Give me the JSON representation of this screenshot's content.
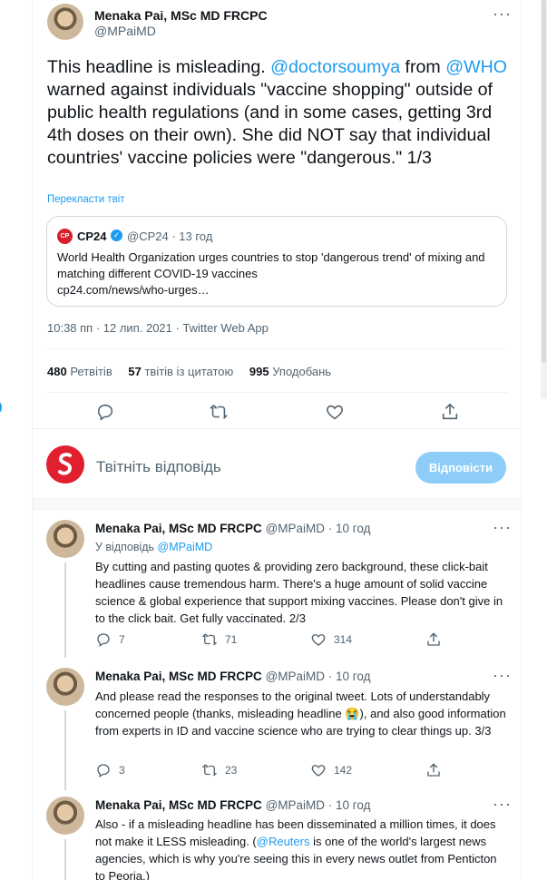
{
  "main_tweet": {
    "name": "Menaka Pai, MSc MD FRCPC",
    "handle": "@MPaiMD",
    "text_part1": "This headline is misleading. ",
    "mention1": "@doctorsoumya",
    "text_part2": " from ",
    "mention2": "@WHO",
    "text_part3": "  warned against individuals \"vaccine shopping\" outside of public health regulations (and in some cases, getting 3rd 4th doses on their own). She did NOT say that individual countries' vaccine policies were \"dangerous.\" 1/3",
    "translate_label": "Перекласти твіт",
    "quote": {
      "logo_text": "CP",
      "name": "CP24",
      "handle_time": "@CP24 · 13 год",
      "text": "World Health Organization urges countries to stop 'dangerous trend' of mixing and matching different COVID-19 vaccines",
      "link": "cp24.com/news/who-urges…"
    },
    "timestamp": "10:38 пп · 12 лип. 2021 · Twitter Web App",
    "stats": {
      "retweets_count": "480",
      "retweets_label": "Ретвітів",
      "quotes_count": "57",
      "quotes_label": "твітів із цитатою",
      "likes_count": "995",
      "likes_label": "Уподобань"
    }
  },
  "reply_box": {
    "placeholder": "Твітніть відповідь",
    "button_label": "Відповісти"
  },
  "replies": [
    {
      "name": "Menaka Pai, MSc MD FRCPC",
      "handle_time": "@MPaiMD · 10 год",
      "replying_prefix": "У відповідь ",
      "replying_to": "@MPaiMD",
      "text": "By cutting and pasting quotes & providing zero background, these click-bait headlines cause tremendous harm. There's a huge amount of solid vaccine science & global experience that support mixing vaccines. Please don't give in to the click bait. Get fully vaccinated. 2/3",
      "replies": "7",
      "retweets": "71",
      "likes": "314"
    },
    {
      "name": "Menaka Pai, MSc MD FRCPC",
      "handle_time": "@MPaiMD · 10 год",
      "text": "And please read the responses to the original tweet. Lots of understandably concerned people (thanks, misleading headline 😭), and also good information from experts in ID and vaccine science who are trying to clear things up. 3/3",
      "replies": "3",
      "retweets": "23",
      "likes": "142"
    },
    {
      "name": "Menaka Pai, MSc MD FRCPC",
      "handle_time": "@MPaiMD · 10 год",
      "text_part1": "Also - if a misleading headline has been disseminated a million times, it does not make it LESS misleading. (",
      "mention": "@Reuters",
      "text_part2": " is one of the world's largest news agencies, which is why you're seeing this in every news outlet from Penticton to Peoria.)"
    }
  ],
  "icons": {
    "more": "more-horizontal-icon",
    "reply": "reply-icon",
    "retweet": "retweet-icon",
    "like": "heart-icon",
    "share": "share-icon",
    "verified": "verified-badge-icon"
  },
  "colors": {
    "accent": "#1d9bf0",
    "muted": "#536471",
    "reply_button": "#8ecdf7",
    "brand_red": "#e0202e"
  }
}
